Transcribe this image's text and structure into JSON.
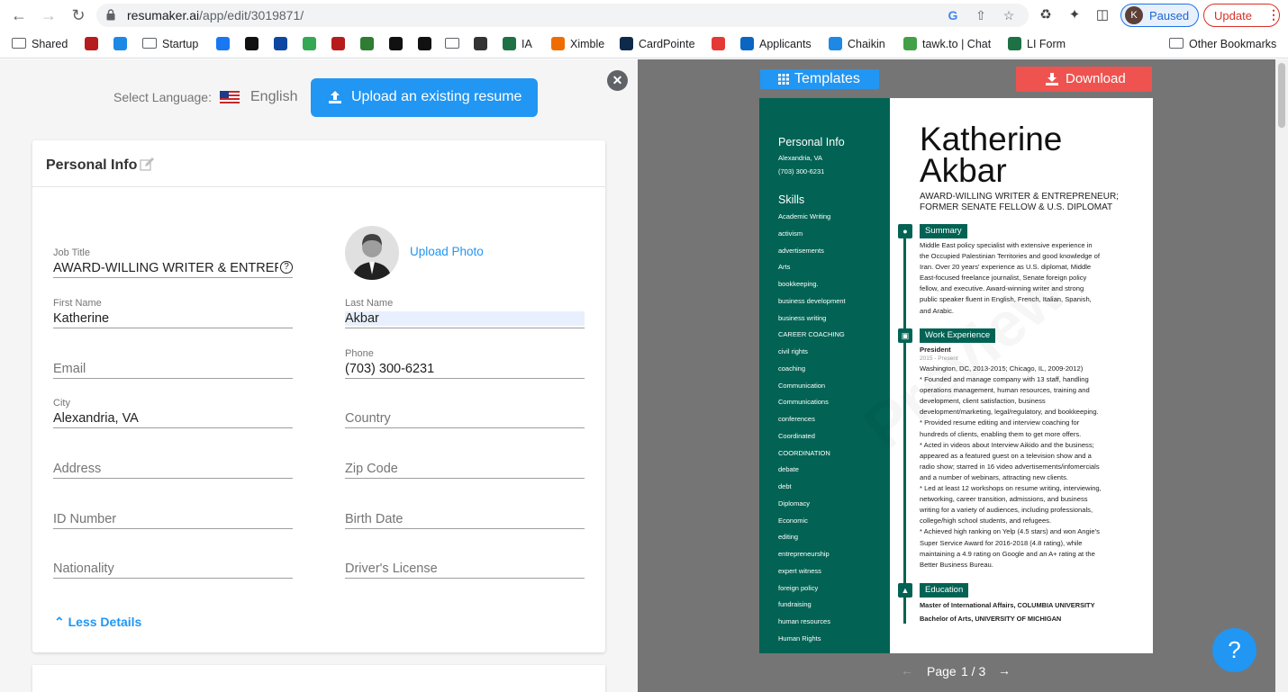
{
  "browser": {
    "url_host": "resumaker.ai",
    "url_path": "/app/edit/3019871/",
    "profile_initial": "K",
    "profile_status": "Paused",
    "update_label": "Update"
  },
  "bookmarks": [
    {
      "label": "Shared",
      "icon": "folder-icon"
    },
    {
      "label": "",
      "icon": "yc-icon",
      "color": "#b71c1c"
    },
    {
      "label": "",
      "icon": "circle-icon",
      "color": "#1e88e5"
    },
    {
      "label": "Startup",
      "icon": "folder-icon"
    },
    {
      "label": "",
      "icon": "facebook-icon",
      "color": "#1877f2"
    },
    {
      "label": "",
      "icon": "amazon-icon",
      "color": "#111111"
    },
    {
      "label": "",
      "icon": "x-icon",
      "color": "#0d47a1"
    },
    {
      "label": "",
      "icon": "drive-icon",
      "color": "#34a853"
    },
    {
      "label": "",
      "icon": "yc-icon",
      "color": "#b71c1c"
    },
    {
      "label": "",
      "icon": "green-circle-icon",
      "color": "#2e7d32"
    },
    {
      "label": "",
      "icon": "v-icon",
      "color": "#111111"
    },
    {
      "label": "",
      "icon": "globe-icon",
      "color": "#111111"
    },
    {
      "label": "",
      "icon": "folder-icon"
    },
    {
      "label": "",
      "icon": "clock-icon",
      "color": "#333333"
    },
    {
      "label": "IA",
      "icon": "excel-icon",
      "color": "#1e7145"
    },
    {
      "label": "Ximble",
      "icon": "arrow-icon",
      "color": "#ef6c00"
    },
    {
      "label": "CardPointe",
      "icon": "card-icon",
      "color": "#0d2a4a"
    },
    {
      "label": "",
      "icon": "mb-icon",
      "color": "#e53935"
    },
    {
      "label": "Applicants",
      "icon": "linkedin-icon",
      "color": "#0a66c2"
    },
    {
      "label": "Chaikin",
      "icon": "wave-icon",
      "color": "#1e88e5"
    },
    {
      "label": "tawk.to | Chat",
      "icon": "tawk-icon",
      "color": "#43a047"
    },
    {
      "label": "LI Form",
      "icon": "excel-icon",
      "color": "#1e7145"
    },
    {
      "label": "Other Bookmarks",
      "icon": "folder-icon"
    }
  ],
  "editor": {
    "language_label": "Select Language:",
    "language": "English",
    "upload_button": "Upload an existing resume",
    "card_title": "Personal Info",
    "upload_photo": "Upload Photo",
    "less_details": "Less Details",
    "fields": {
      "job_title": {
        "label": "Job Title",
        "value": "AWARD-WILLING WRITER & ENTREPRENEUR; FORMER SENATE FELLOW & U.S. DIPLOMAT"
      },
      "first_name": {
        "label": "First Name",
        "value": "Katherine"
      },
      "last_name": {
        "label": "Last Name",
        "value": "Akbar"
      },
      "email": {
        "placeholder": "Email"
      },
      "phone": {
        "label": "Phone",
        "value": "(703) 300-6231"
      },
      "city": {
        "label": "City",
        "value": "Alexandria, VA"
      },
      "country": {
        "placeholder": "Country"
      },
      "address": {
        "placeholder": "Address"
      },
      "zip": {
        "placeholder": "Zip Code"
      },
      "id_number": {
        "placeholder": "ID Number"
      },
      "birth_date": {
        "placeholder": "Birth Date"
      },
      "nationality": {
        "placeholder": "Nationality"
      },
      "drivers_license": {
        "placeholder": "Driver's License"
      }
    }
  },
  "preview": {
    "templates_button": "Templates",
    "download_button": "Download",
    "page_label": "Page",
    "page_current": "1 / 3",
    "help": "?",
    "watermark": "Preview",
    "resume": {
      "name_first": "Katherine",
      "name_last": "Akbar",
      "title_line1": "AWARD-WILLING WRITER & ENTREPRENEUR;",
      "title_line2": "FORMER SENATE FELLOW & U.S. DIPLOMAT",
      "personal_info_heading": "Personal Info",
      "city": "Alexandria, VA",
      "phone": "(703) 300-6231",
      "skills_heading": "Skills",
      "skills": [
        "Academic Writing",
        "activism",
        "advertisements",
        "Arts",
        "bookkeeping.",
        "business development",
        "business writing",
        "CAREER COACHING",
        "civil rights",
        "coaching",
        "Communication",
        "Communications",
        "conferences",
        "Coordinated",
        "COORDINATION",
        "debate",
        "debt",
        "Diplomacy",
        "Economic",
        "editing",
        "entrepreneurship",
        "expert witness",
        "foreign policy",
        "fundraising",
        "human resources",
        "Human Rights"
      ],
      "summary_heading": "Summary",
      "summary_lines": [
        "Middle East policy specialist with extensive experience in",
        "the Occupied Palestinian Territories and good knowledge of",
        "Iran. Over 20 years' experience as U.S. diplomat, Middle",
        "East-focused freelance journalist, Senate foreign policy",
        "fellow, and executive. Award-winning writer and strong",
        "public speaker fluent in English, French, Italian, Spanish,",
        "and Arabic."
      ],
      "work_heading": "Work Experience",
      "job_title": "President",
      "job_dates": "2015 - Present",
      "work_lines": [
        "Washington, DC, 2013-2015; Chicago, IL, 2009-2012)",
        "* Founded and manage company with 13 staff, handling",
        "operations management, human resources, training and",
        "development, client satisfaction, business",
        "development/marketing, legal/regulatory, and bookkeeping.",
        "* Provided resume editing and interview coaching for",
        "hundreds of clients, enabling them to get more offers.",
        "* Acted in videos about Interview Aikido and the business;",
        "appeared as a featured guest on a television show and a",
        "radio show; starred in 16 video advertisements/infomercials",
        "and a number of webinars, attracting new clients.",
        "* Led at least 12 workshops on resume writing, interviewing,",
        "networking, career transition, admissions, and business",
        "writing for a variety of audiences, including professionals,",
        "college/high school students, and refugees.",
        "* Achieved high ranking on Yelp (4.5 stars) and won Angie's",
        "Super Service Award for 2016-2018 (4.8 rating), while",
        "maintaining a 4.9 rating on Google and an A+ rating at the",
        "Better Business Bureau."
      ],
      "education_heading": "Education",
      "education": [
        "Master of International Affairs, COLUMBIA UNIVERSITY",
        "Bachelor of Arts, UNIVERSITY OF MICHIGAN"
      ]
    }
  }
}
